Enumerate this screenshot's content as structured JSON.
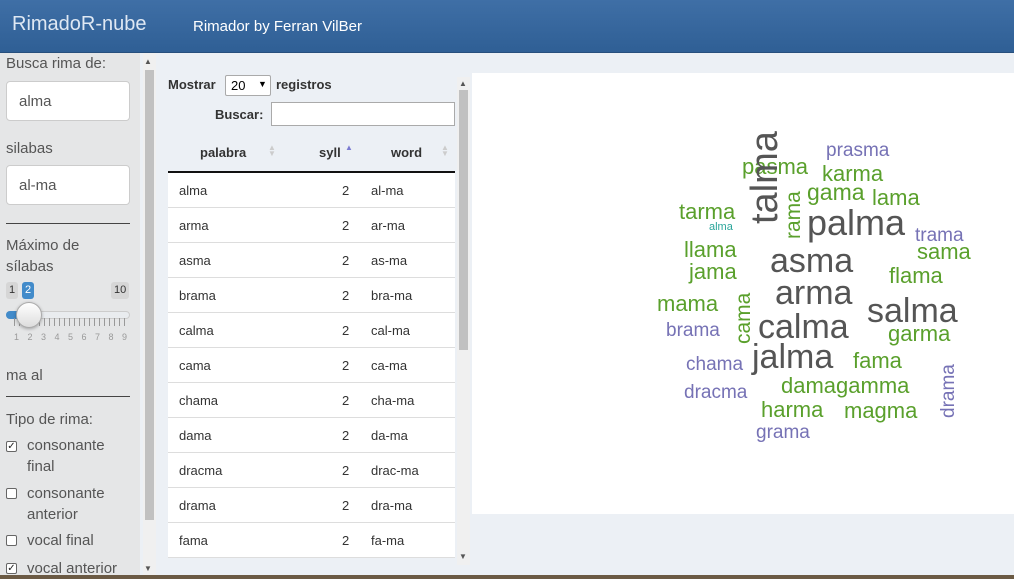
{
  "app": {
    "brand": "RimadoR-nube",
    "nav_link": "Rimador by Ferran VilBer"
  },
  "sidebar": {
    "search_label": "Busca rima de:",
    "search_value": "alma",
    "syllables_label": "silabas",
    "syllables_value": "al-ma",
    "max_syll_label_1": "Máximo de",
    "max_syll_label_2": "sílabas",
    "slider": {
      "min": "1",
      "value": "2",
      "max": "10",
      "tick_labels": "1 2 3 4 5 6 7 8 9"
    },
    "ending_text": "ma al",
    "rhyme_type_label": "Tipo de rima:",
    "options": [
      {
        "line1": "consonante",
        "line2": "final",
        "checked": true
      },
      {
        "line1": "consonante",
        "line2": "anterior",
        "checked": false
      },
      {
        "line1": "vocal final",
        "line2": "",
        "checked": false
      },
      {
        "line1": "vocal anterior",
        "line2": "",
        "checked": true
      }
    ]
  },
  "table_controls": {
    "show_label": "Mostrar",
    "page_length": "20",
    "records_label": "registros",
    "search_label": "Buscar:",
    "search_value": ""
  },
  "table": {
    "headers": [
      "palabra",
      "syll",
      "word"
    ],
    "rows": [
      [
        "alma",
        "2",
        "al-ma"
      ],
      [
        "arma",
        "2",
        "ar-ma"
      ],
      [
        "asma",
        "2",
        "as-ma"
      ],
      [
        "brama",
        "2",
        "bra-ma"
      ],
      [
        "calma",
        "2",
        "cal-ma"
      ],
      [
        "cama",
        "2",
        "ca-ma"
      ],
      [
        "chama",
        "2",
        "cha-ma"
      ],
      [
        "dama",
        "2",
        "da-ma"
      ],
      [
        "dracma",
        "2",
        "drac-ma"
      ],
      [
        "drama",
        "2",
        "dra-ma"
      ],
      [
        "fama",
        "2",
        "fa-ma"
      ]
    ]
  },
  "cloud": {
    "colors": {
      "grey": "#555555",
      "green": "#5aa02c",
      "purple": "#7672b5",
      "teal": "#2aa59a"
    },
    "words": [
      {
        "t": "prasma",
        "c": "purple",
        "s": 19
      },
      {
        "t": "pasma",
        "c": "green",
        "s": 22
      },
      {
        "t": "karma",
        "c": "green",
        "s": 22
      },
      {
        "t": "gama",
        "c": "green",
        "s": 23
      },
      {
        "t": "lama",
        "c": "green",
        "s": 22
      },
      {
        "t": "tarma",
        "c": "green",
        "s": 22
      },
      {
        "t": "alma",
        "c": "teal",
        "s": 11
      },
      {
        "t": "talma",
        "c": "grey",
        "s": 38,
        "v": true
      },
      {
        "t": "rama",
        "c": "green",
        "s": 21,
        "v": true
      },
      {
        "t": "palma",
        "c": "grey",
        "s": 36
      },
      {
        "t": "trama",
        "c": "purple",
        "s": 19
      },
      {
        "t": "llama",
        "c": "green",
        "s": 22
      },
      {
        "t": "sama",
        "c": "green",
        "s": 22
      },
      {
        "t": "asma",
        "c": "grey",
        "s": 34
      },
      {
        "t": "jama",
        "c": "green",
        "s": 22
      },
      {
        "t": "flama",
        "c": "green",
        "s": 22
      },
      {
        "t": "arma",
        "c": "grey",
        "s": 34
      },
      {
        "t": "mama",
        "c": "green",
        "s": 22
      },
      {
        "t": "salma",
        "c": "grey",
        "s": 34
      },
      {
        "t": "cama",
        "c": "green",
        "s": 21,
        "v": true
      },
      {
        "t": "brama",
        "c": "purple",
        "s": 19
      },
      {
        "t": "calma",
        "c": "grey",
        "s": 34
      },
      {
        "t": "garma",
        "c": "green",
        "s": 22
      },
      {
        "t": "chama",
        "c": "purple",
        "s": 19
      },
      {
        "t": "jalma",
        "c": "grey",
        "s": 34
      },
      {
        "t": "fama",
        "c": "green",
        "s": 22
      },
      {
        "t": "drama",
        "c": "purple",
        "s": 19,
        "v": true
      },
      {
        "t": "dracma",
        "c": "purple",
        "s": 19
      },
      {
        "t": "damagamma",
        "c": "green",
        "s": 22
      },
      {
        "t": "harma",
        "c": "green",
        "s": 22
      },
      {
        "t": "magma",
        "c": "green",
        "s": 22
      },
      {
        "t": "grama",
        "c": "purple",
        "s": 19
      }
    ]
  }
}
